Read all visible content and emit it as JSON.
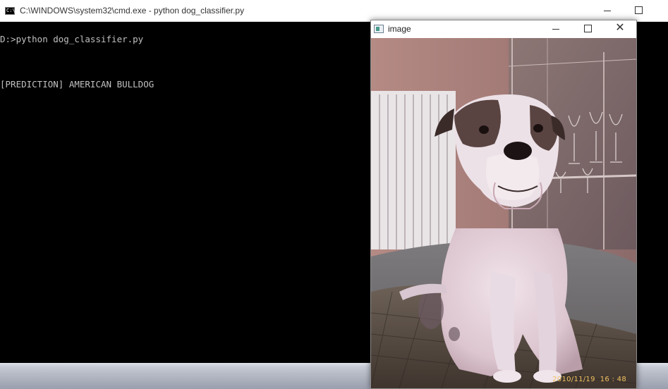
{
  "cmd": {
    "title": "C:\\WINDOWS\\system32\\cmd.exe - python  dog_classifier.py",
    "icon_text": "C:\\",
    "lines": [
      "D:>python dog_classifier.py",
      "[PREDICTION] AMERICAN BULLDOG"
    ]
  },
  "image_window": {
    "title": "image",
    "timestamp": "2010/11/19  16 : 48"
  },
  "icons": {
    "cmd": "console-icon",
    "image": "image-window-icon",
    "minimize": "minimize-icon",
    "maximize": "maximize-icon",
    "close": "close-icon"
  }
}
